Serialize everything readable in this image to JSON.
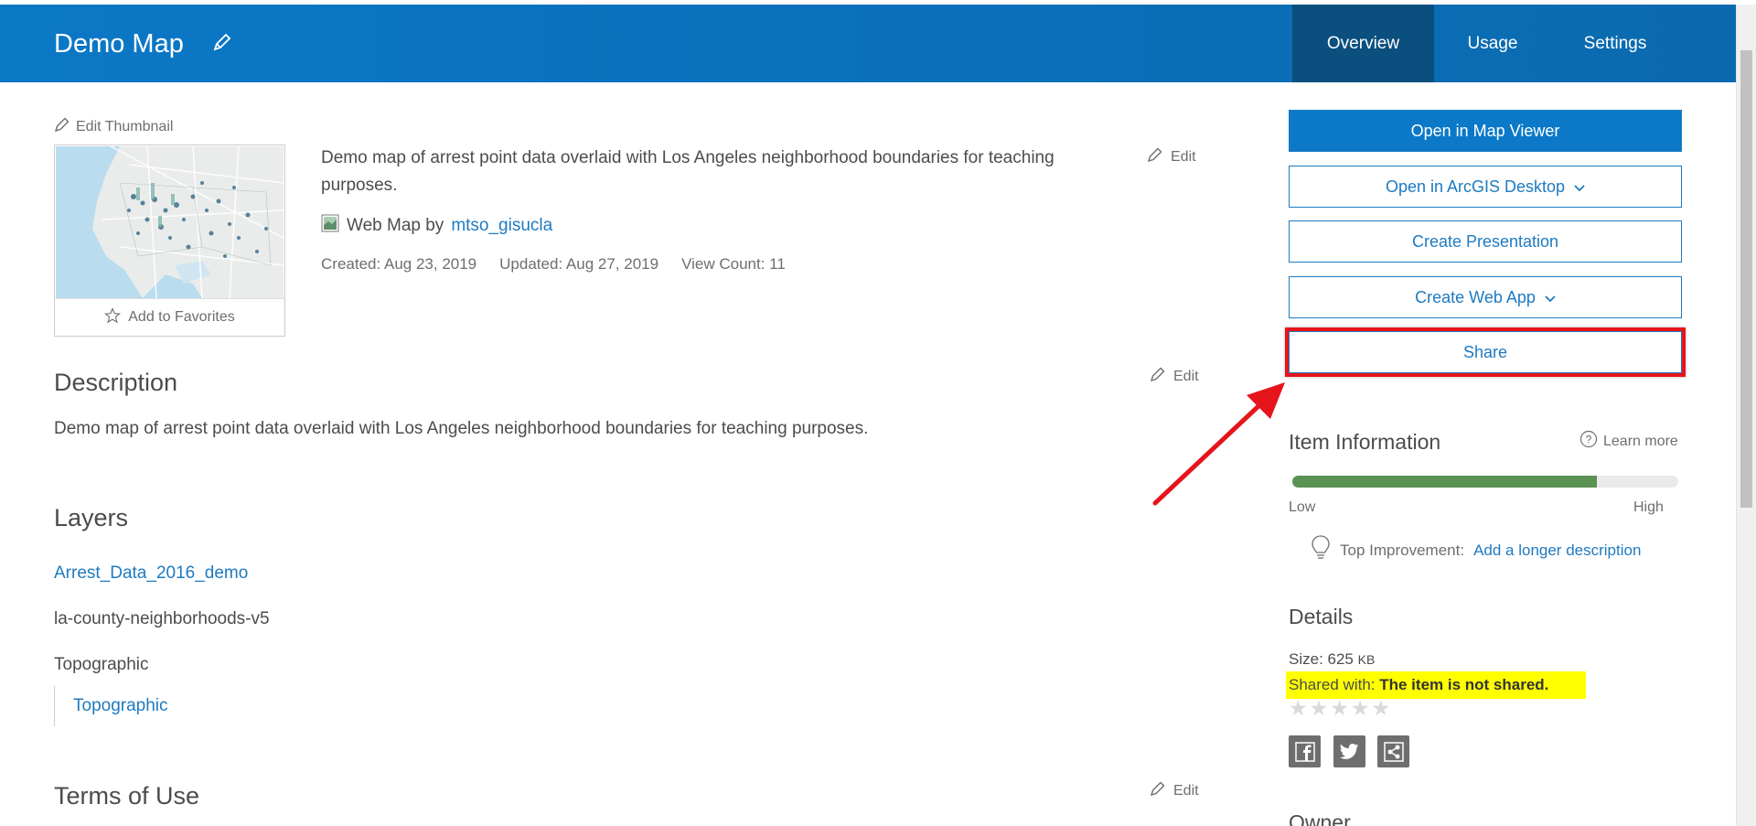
{
  "header": {
    "title": "Demo Map",
    "tabs": [
      {
        "label": "Overview",
        "active": true
      },
      {
        "label": "Usage",
        "active": false
      },
      {
        "label": "Settings",
        "active": false
      }
    ]
  },
  "thumbnail": {
    "edit_label": "Edit Thumbnail",
    "favorites_label": "Add to Favorites"
  },
  "summary": {
    "text": "Demo map of arrest point data overlaid with Los Angeles neighborhood boundaries for teaching purposes.",
    "edit_label": "Edit",
    "item_type": "Web Map by",
    "owner": "mtso_gisucla",
    "created": "Created: Aug 23, 2019",
    "updated": "Updated: Aug 27, 2019",
    "view_count": "View Count: 11"
  },
  "description": {
    "heading": "Description",
    "edit_label": "Edit",
    "text": "Demo map of arrest point data overlaid with Los Angeles neighborhood boundaries for teaching purposes."
  },
  "layers": {
    "heading": "Layers",
    "items": [
      "Arrest_Data_2016_demo",
      "la-county-neighborhoods-v5",
      "Topographic"
    ],
    "sublayer": "Topographic"
  },
  "terms": {
    "heading": "Terms of Use",
    "edit_label": "Edit"
  },
  "actions": {
    "open_map_viewer": "Open in Map Viewer",
    "open_desktop": "Open in ArcGIS Desktop",
    "create_presentation": "Create Presentation",
    "create_web_app": "Create Web App",
    "share": "Share"
  },
  "item_info": {
    "heading": "Item Information",
    "learn_more": "Learn more",
    "score_fraction": 0.79,
    "low": "Low",
    "high": "High",
    "top_improvement_label": "Top Improvement:",
    "top_improvement_link": "Add a longer description"
  },
  "details": {
    "heading": "Details",
    "size_label": "Size: 625",
    "size_unit": "KB",
    "shared_label": "Shared with:",
    "shared_value": "The item is not shared.",
    "rating_stars": 0
  },
  "owner": {
    "heading": "Owner"
  },
  "colors": {
    "header": "#0a72bf",
    "active_tab": "#0a4f7e",
    "link": "#1e7ac0",
    "progress": "#5a9155",
    "highlight": "#ffff00",
    "annotation": "#e6141b"
  }
}
